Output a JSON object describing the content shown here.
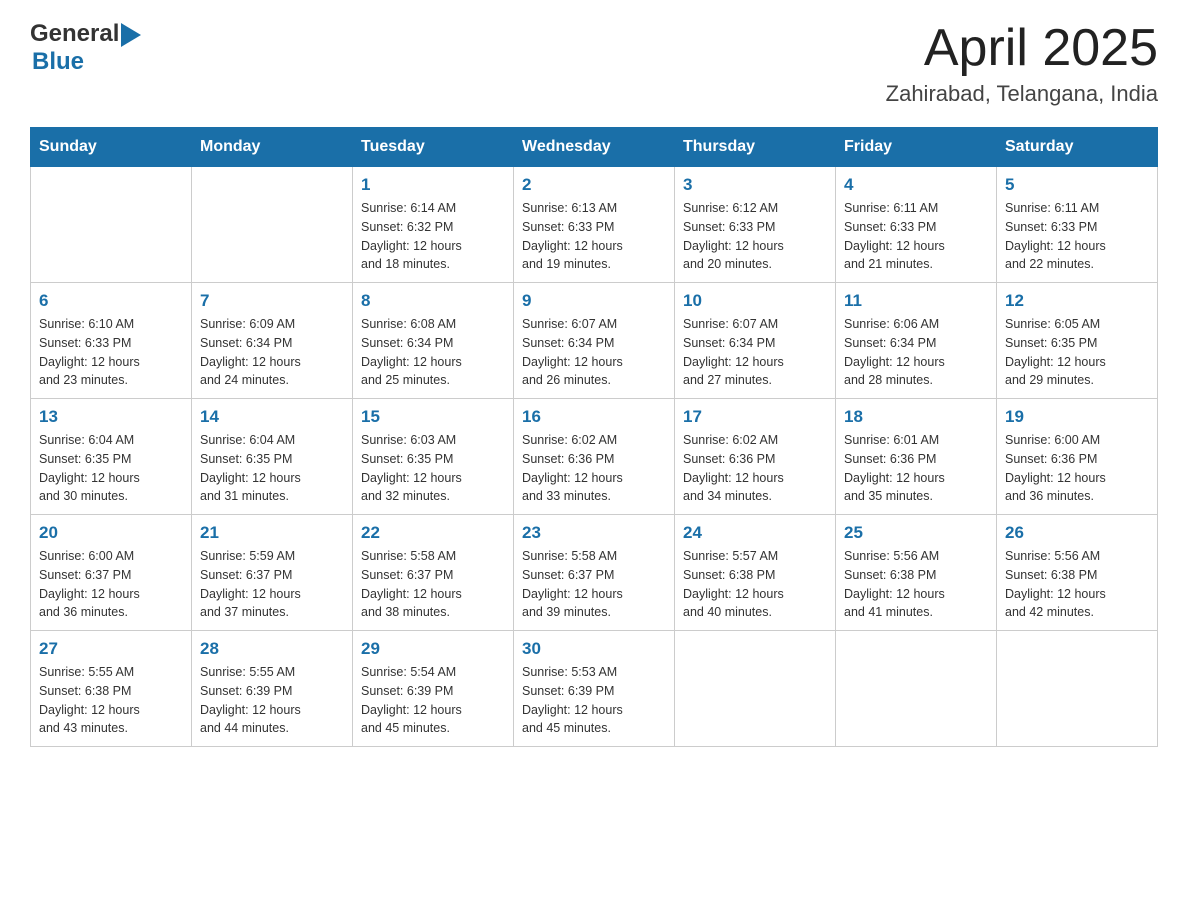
{
  "header": {
    "logo_general": "General",
    "logo_blue": "Blue",
    "month_title": "April 2025",
    "location": "Zahirabad, Telangana, India"
  },
  "days_of_week": [
    "Sunday",
    "Monday",
    "Tuesday",
    "Wednesday",
    "Thursday",
    "Friday",
    "Saturday"
  ],
  "weeks": [
    [
      {
        "day": "",
        "info": ""
      },
      {
        "day": "",
        "info": ""
      },
      {
        "day": "1",
        "info": "Sunrise: 6:14 AM\nSunset: 6:32 PM\nDaylight: 12 hours\nand 18 minutes."
      },
      {
        "day": "2",
        "info": "Sunrise: 6:13 AM\nSunset: 6:33 PM\nDaylight: 12 hours\nand 19 minutes."
      },
      {
        "day": "3",
        "info": "Sunrise: 6:12 AM\nSunset: 6:33 PM\nDaylight: 12 hours\nand 20 minutes."
      },
      {
        "day": "4",
        "info": "Sunrise: 6:11 AM\nSunset: 6:33 PM\nDaylight: 12 hours\nand 21 minutes."
      },
      {
        "day": "5",
        "info": "Sunrise: 6:11 AM\nSunset: 6:33 PM\nDaylight: 12 hours\nand 22 minutes."
      }
    ],
    [
      {
        "day": "6",
        "info": "Sunrise: 6:10 AM\nSunset: 6:33 PM\nDaylight: 12 hours\nand 23 minutes."
      },
      {
        "day": "7",
        "info": "Sunrise: 6:09 AM\nSunset: 6:34 PM\nDaylight: 12 hours\nand 24 minutes."
      },
      {
        "day": "8",
        "info": "Sunrise: 6:08 AM\nSunset: 6:34 PM\nDaylight: 12 hours\nand 25 minutes."
      },
      {
        "day": "9",
        "info": "Sunrise: 6:07 AM\nSunset: 6:34 PM\nDaylight: 12 hours\nand 26 minutes."
      },
      {
        "day": "10",
        "info": "Sunrise: 6:07 AM\nSunset: 6:34 PM\nDaylight: 12 hours\nand 27 minutes."
      },
      {
        "day": "11",
        "info": "Sunrise: 6:06 AM\nSunset: 6:34 PM\nDaylight: 12 hours\nand 28 minutes."
      },
      {
        "day": "12",
        "info": "Sunrise: 6:05 AM\nSunset: 6:35 PM\nDaylight: 12 hours\nand 29 minutes."
      }
    ],
    [
      {
        "day": "13",
        "info": "Sunrise: 6:04 AM\nSunset: 6:35 PM\nDaylight: 12 hours\nand 30 minutes."
      },
      {
        "day": "14",
        "info": "Sunrise: 6:04 AM\nSunset: 6:35 PM\nDaylight: 12 hours\nand 31 minutes."
      },
      {
        "day": "15",
        "info": "Sunrise: 6:03 AM\nSunset: 6:35 PM\nDaylight: 12 hours\nand 32 minutes."
      },
      {
        "day": "16",
        "info": "Sunrise: 6:02 AM\nSunset: 6:36 PM\nDaylight: 12 hours\nand 33 minutes."
      },
      {
        "day": "17",
        "info": "Sunrise: 6:02 AM\nSunset: 6:36 PM\nDaylight: 12 hours\nand 34 minutes."
      },
      {
        "day": "18",
        "info": "Sunrise: 6:01 AM\nSunset: 6:36 PM\nDaylight: 12 hours\nand 35 minutes."
      },
      {
        "day": "19",
        "info": "Sunrise: 6:00 AM\nSunset: 6:36 PM\nDaylight: 12 hours\nand 36 minutes."
      }
    ],
    [
      {
        "day": "20",
        "info": "Sunrise: 6:00 AM\nSunset: 6:37 PM\nDaylight: 12 hours\nand 36 minutes."
      },
      {
        "day": "21",
        "info": "Sunrise: 5:59 AM\nSunset: 6:37 PM\nDaylight: 12 hours\nand 37 minutes."
      },
      {
        "day": "22",
        "info": "Sunrise: 5:58 AM\nSunset: 6:37 PM\nDaylight: 12 hours\nand 38 minutes."
      },
      {
        "day": "23",
        "info": "Sunrise: 5:58 AM\nSunset: 6:37 PM\nDaylight: 12 hours\nand 39 minutes."
      },
      {
        "day": "24",
        "info": "Sunrise: 5:57 AM\nSunset: 6:38 PM\nDaylight: 12 hours\nand 40 minutes."
      },
      {
        "day": "25",
        "info": "Sunrise: 5:56 AM\nSunset: 6:38 PM\nDaylight: 12 hours\nand 41 minutes."
      },
      {
        "day": "26",
        "info": "Sunrise: 5:56 AM\nSunset: 6:38 PM\nDaylight: 12 hours\nand 42 minutes."
      }
    ],
    [
      {
        "day": "27",
        "info": "Sunrise: 5:55 AM\nSunset: 6:38 PM\nDaylight: 12 hours\nand 43 minutes."
      },
      {
        "day": "28",
        "info": "Sunrise: 5:55 AM\nSunset: 6:39 PM\nDaylight: 12 hours\nand 44 minutes."
      },
      {
        "day": "29",
        "info": "Sunrise: 5:54 AM\nSunset: 6:39 PM\nDaylight: 12 hours\nand 45 minutes."
      },
      {
        "day": "30",
        "info": "Sunrise: 5:53 AM\nSunset: 6:39 PM\nDaylight: 12 hours\nand 45 minutes."
      },
      {
        "day": "",
        "info": ""
      },
      {
        "day": "",
        "info": ""
      },
      {
        "day": "",
        "info": ""
      }
    ]
  ]
}
